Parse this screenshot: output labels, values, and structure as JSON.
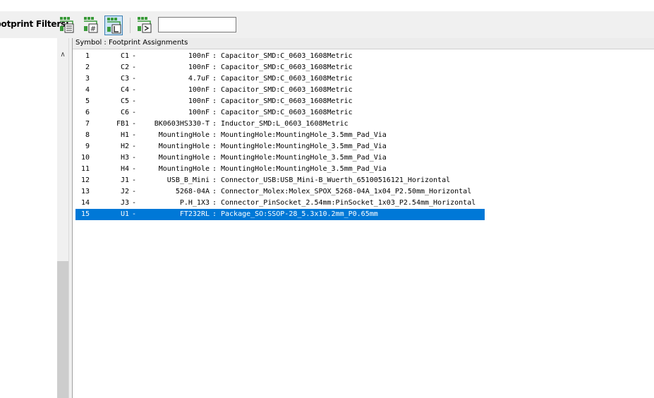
{
  "toolbar": {
    "filters_label": "Footprint Filters:",
    "filter_buttons": [
      {
        "icon": "filter-by-keywords-icon",
        "active": false
      },
      {
        "icon": "filter-by-pin-count-icon",
        "active": false
      },
      {
        "icon": "filter-by-library-icon",
        "active": true
      },
      {
        "icon": "filter-by-text-icon",
        "active": false
      }
    ],
    "filter_text_value": ""
  },
  "list": {
    "header": "Symbol : Footprint Assignments",
    "selected_index": 14,
    "rows": [
      {
        "num": "1",
        "ref": "C1",
        "dash": "-",
        "value": "100nF",
        "sep": ":",
        "footprint": "Capacitor_SMD:C_0603_1608Metric"
      },
      {
        "num": "2",
        "ref": "C2",
        "dash": "-",
        "value": "100nF",
        "sep": ":",
        "footprint": "Capacitor_SMD:C_0603_1608Metric"
      },
      {
        "num": "3",
        "ref": "C3",
        "dash": "-",
        "value": "4.7uF",
        "sep": ":",
        "footprint": "Capacitor_SMD:C_0603_1608Metric"
      },
      {
        "num": "4",
        "ref": "C4",
        "dash": "-",
        "value": "100nF",
        "sep": ":",
        "footprint": "Capacitor_SMD:C_0603_1608Metric"
      },
      {
        "num": "5",
        "ref": "C5",
        "dash": "-",
        "value": "100nF",
        "sep": ":",
        "footprint": "Capacitor_SMD:C_0603_1608Metric"
      },
      {
        "num": "6",
        "ref": "C6",
        "dash": "-",
        "value": "100nF",
        "sep": ":",
        "footprint": "Capacitor_SMD:C_0603_1608Metric"
      },
      {
        "num": "7",
        "ref": "FB1",
        "dash": "-",
        "value": "BK0603HS330-T",
        "sep": ":",
        "footprint": "Inductor_SMD:L_0603_1608Metric"
      },
      {
        "num": "8",
        "ref": "H1",
        "dash": "-",
        "value": "MountingHole",
        "sep": ":",
        "footprint": "MountingHole:MountingHole_3.5mm_Pad_Via"
      },
      {
        "num": "9",
        "ref": "H2",
        "dash": "-",
        "value": "MountingHole",
        "sep": ":",
        "footprint": "MountingHole:MountingHole_3.5mm_Pad_Via"
      },
      {
        "num": "10",
        "ref": "H3",
        "dash": "-",
        "value": "MountingHole",
        "sep": ":",
        "footprint": "MountingHole:MountingHole_3.5mm_Pad_Via"
      },
      {
        "num": "11",
        "ref": "H4",
        "dash": "-",
        "value": "MountingHole",
        "sep": ":",
        "footprint": "MountingHole:MountingHole_3.5mm_Pad_Via"
      },
      {
        "num": "12",
        "ref": "J1",
        "dash": "-",
        "value": "USB_B_Mini",
        "sep": ":",
        "footprint": "Connector_USB:USB_Mini-B_Wuerth_65100516121_Horizontal"
      },
      {
        "num": "13",
        "ref": "J2",
        "dash": "-",
        "value": "5268-04A",
        "sep": ":",
        "footprint": "Connector_Molex:Molex_SPOX_5268-04A_1x04_P2.50mm_Horizontal"
      },
      {
        "num": "14",
        "ref": "J3",
        "dash": "-",
        "value": "P.H_1X3",
        "sep": ":",
        "footprint": "Connector_PinSocket_2.54mm:PinSocket_1x03_P2.54mm_Horizontal"
      },
      {
        "num": "15",
        "ref": "U1",
        "dash": "-",
        "value": "FT232RL",
        "sep": ":",
        "footprint": "Package_SO:SSOP-28_5.3x10.2mm_P0.65mm"
      }
    ]
  },
  "colors": {
    "selection": "#0078d7",
    "icon_green": "#3a9a3a",
    "active_button": "#cce4f7"
  }
}
